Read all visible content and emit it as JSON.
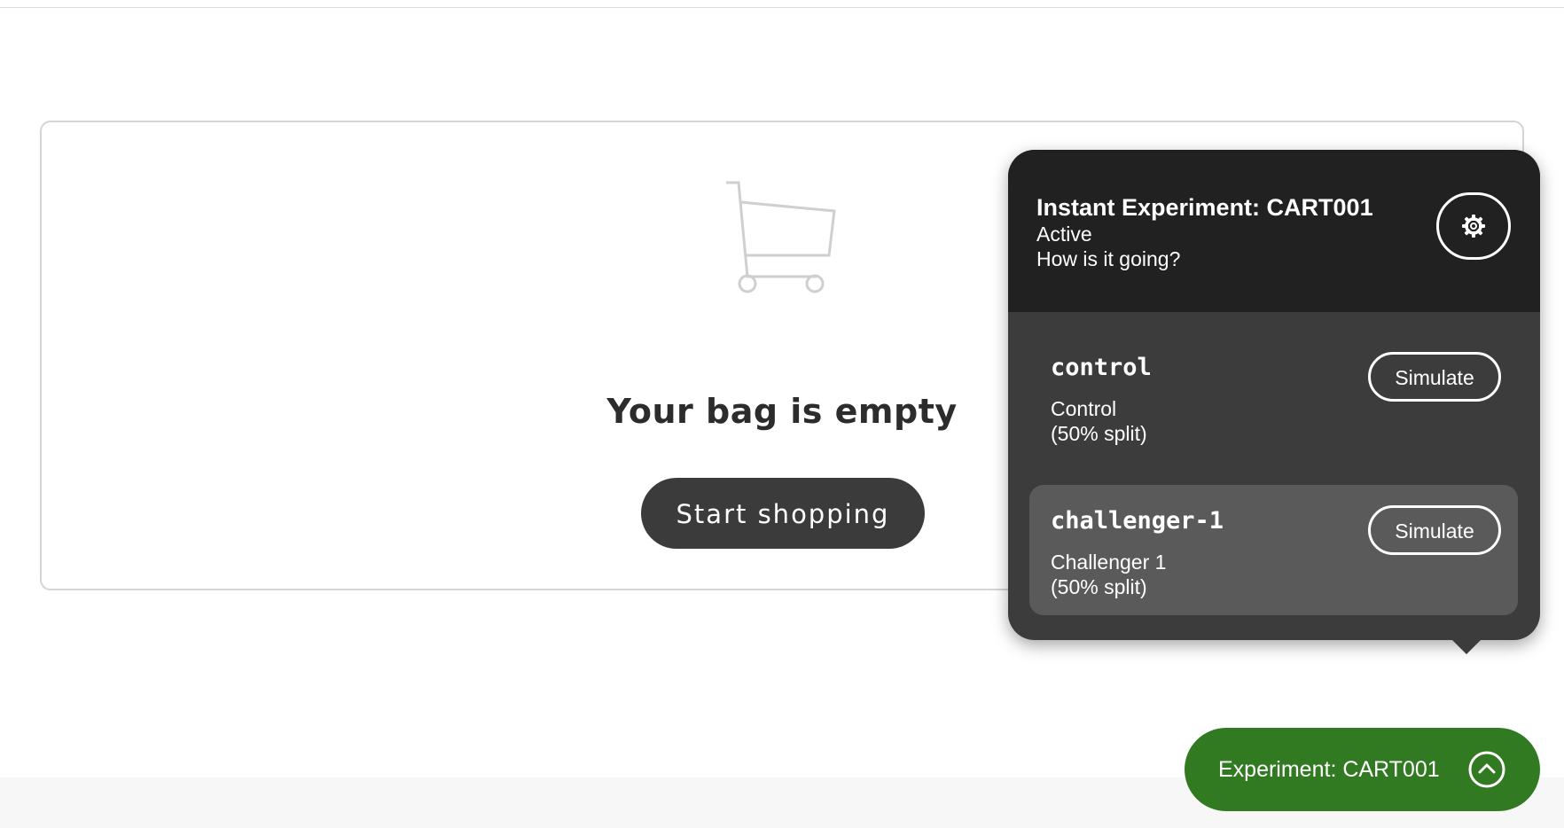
{
  "cart": {
    "empty_title": "Your bag is empty",
    "start_shopping_label": "Start shopping",
    "icon": "shopping-cart-icon"
  },
  "experiment_popover": {
    "title": "Instant Experiment: CART001",
    "status": "Active",
    "question": "How is it going?",
    "settings_icon": "gear-icon",
    "variants": [
      {
        "name": "control",
        "description": "Control",
        "split": "(50% split)",
        "simulate_label": "Simulate",
        "selected": false
      },
      {
        "name": "challenger-1",
        "description": "Challenger 1",
        "split": "(50% split)",
        "simulate_label": "Simulate",
        "selected": true
      }
    ]
  },
  "experiment_pill": {
    "label": "Experiment: CART001",
    "icon": "chevron-up-icon"
  },
  "colors": {
    "accent_green": "#327a21",
    "popover_header": "#212121",
    "popover_body": "#3c3c3c",
    "selected_variant": "#5a5a5a",
    "button_dark": "#3b3b3b"
  }
}
